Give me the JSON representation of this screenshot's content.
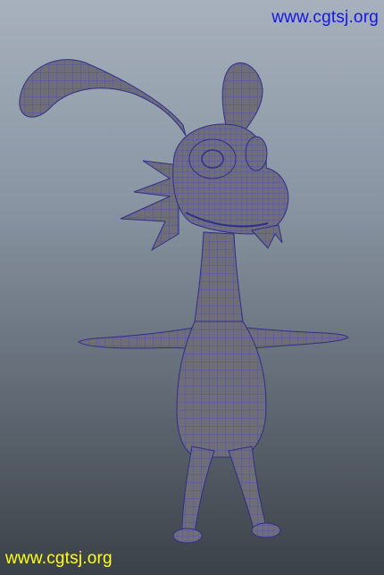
{
  "watermark_top": {
    "text": "www.cgtsj.org",
    "color": "#1515e6"
  },
  "watermark_bottom": {
    "text": "www.cgtsj.org",
    "color": "#ffff1a"
  },
  "viewport": {
    "background_top": "#a6b1bd",
    "background_bottom": "#3b4148"
  },
  "model": {
    "subject": "cartoon rabbit character wireframe mesh",
    "mesh_color": "#4b4bc8",
    "surface_color": "#6e6d78",
    "pose": "T-pose"
  }
}
